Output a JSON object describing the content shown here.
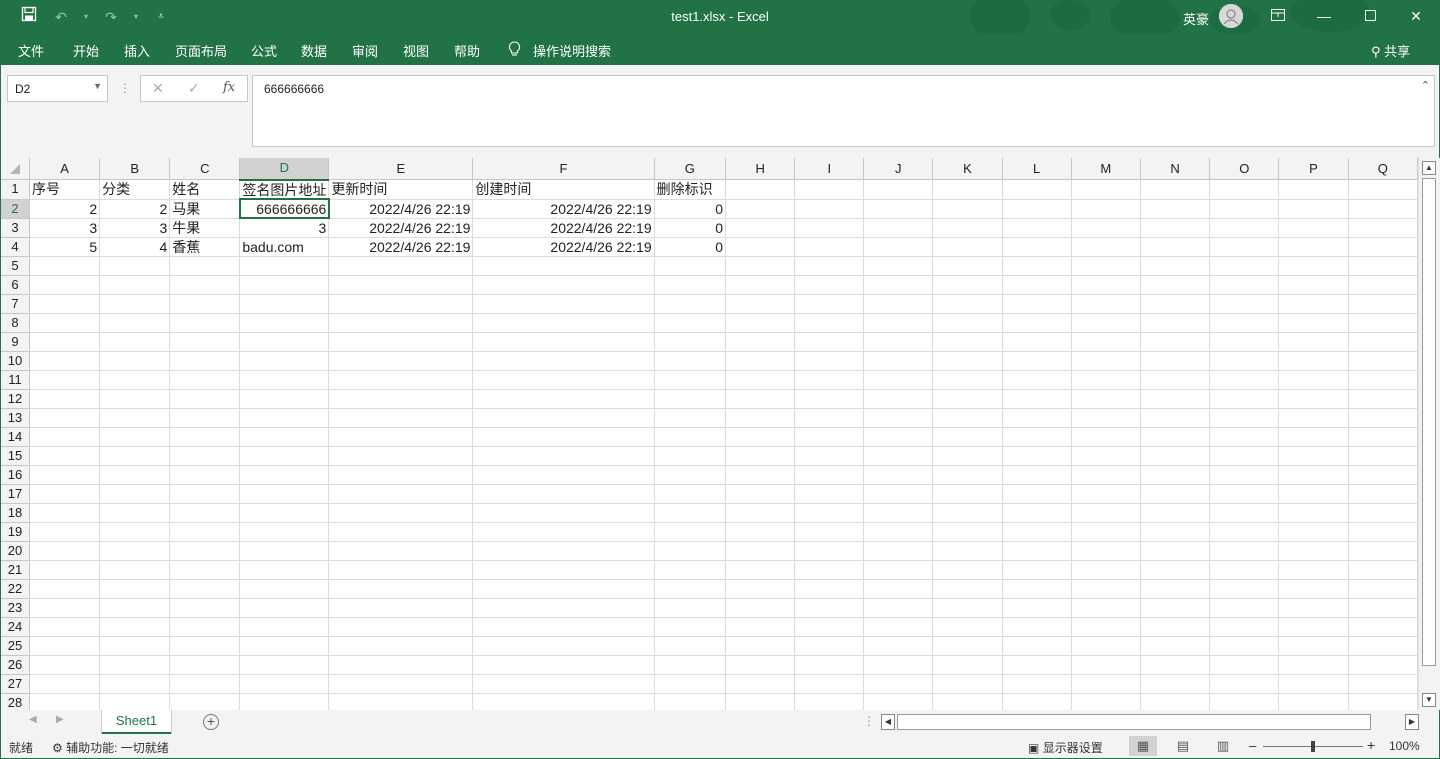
{
  "window": {
    "title": "test1.xlsx  -  Excel",
    "user_name": "英豪",
    "avatar_icon": "user-icon",
    "controls": [
      "ribbon-display-icon",
      "minimize-icon",
      "maximize-icon",
      "close-icon"
    ]
  },
  "quick_access": {
    "save_icon": "save-icon",
    "undo_icon": "undo-icon",
    "redo_icon": "redo-icon",
    "customize_icon": "customize-icon"
  },
  "ribbon": {
    "tabs": [
      "文件",
      "开始",
      "插入",
      "页面布局",
      "公式",
      "数据",
      "审阅",
      "视图",
      "帮助"
    ],
    "tell_me_icon": "lightbulb-icon",
    "tell_me": "操作说明搜索",
    "share": "共享"
  },
  "formula_bar": {
    "name_box": "D2",
    "formula_value": "666666666",
    "fx_label": "fx"
  },
  "grid": {
    "columns": [
      "A",
      "B",
      "C",
      "D",
      "E",
      "F",
      "G",
      "H",
      "I",
      "J",
      "K",
      "L",
      "M",
      "N",
      "O",
      "P",
      "Q"
    ],
    "row_numbers": [
      "1",
      "2",
      "3",
      "4",
      "5",
      "6",
      "7",
      "8",
      "9",
      "10",
      "11",
      "12",
      "13",
      "14",
      "15",
      "16",
      "17",
      "18",
      "19",
      "20",
      "21",
      "22",
      "23",
      "24",
      "25",
      "26",
      "27",
      "28"
    ],
    "active_cell": "D2",
    "data": [
      [
        "序号",
        "分类",
        "姓名",
        "签名图片地址",
        "更新时间",
        "创建时间",
        "删除标识"
      ],
      [
        "2",
        "2",
        "马果",
        "666666666",
        "2022/4/26 22:19",
        "2022/4/26 22:19",
        "0"
      ],
      [
        "3",
        "3",
        "牛果",
        "3",
        "2022/4/26 22:19",
        "2022/4/26 22:19",
        "0"
      ],
      [
        "5",
        "4",
        "香蕉",
        "badu.com",
        "2022/4/26 22:19",
        "2022/4/26 22:19",
        "0"
      ]
    ]
  },
  "sheets": {
    "tabs": [
      "Sheet1"
    ],
    "active": "Sheet1"
  },
  "status_bar": {
    "ready": "就绪",
    "accessibility": "辅助功能: 一切就绪",
    "display_settings": "显示器设置",
    "zoom": "100%"
  },
  "colors": {
    "excel_green": "#217346",
    "header_bg": "#f3f3f3"
  }
}
